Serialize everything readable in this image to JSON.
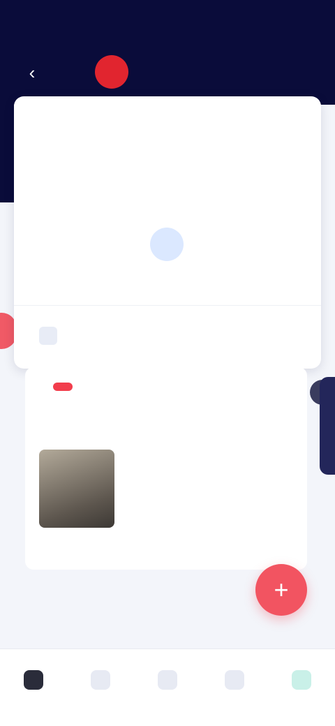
{
  "status_bar": {
    "time": "",
    "icons": ""
  },
  "header": {
    "back_icon": "back-arrow-icon",
    "logo_text": "",
    "brand": ""
  },
  "calendar": {
    "title": "",
    "action": "",
    "weekdays": [
      "",
      "",
      "",
      "",
      "",
      "",
      ""
    ],
    "days": [
      "",
      "",
      "",
      "",
      "",
      "",
      ""
    ],
    "footer_label": "",
    "footer_right": ""
  },
  "news": {
    "badge": "",
    "pill": "",
    "headline": "",
    "summary": "",
    "link": ""
  },
  "section": {
    "title": ""
  },
  "fab": {
    "label": "+"
  },
  "mini_label": "",
  "nav": {
    "items": [
      "",
      "",
      "",
      "",
      ""
    ]
  },
  "colors": {
    "header_bg": "#0a0c3a",
    "brand_red": "#e1252f",
    "accent_blue": "#1e78e6",
    "fab_red": "#f25461"
  }
}
